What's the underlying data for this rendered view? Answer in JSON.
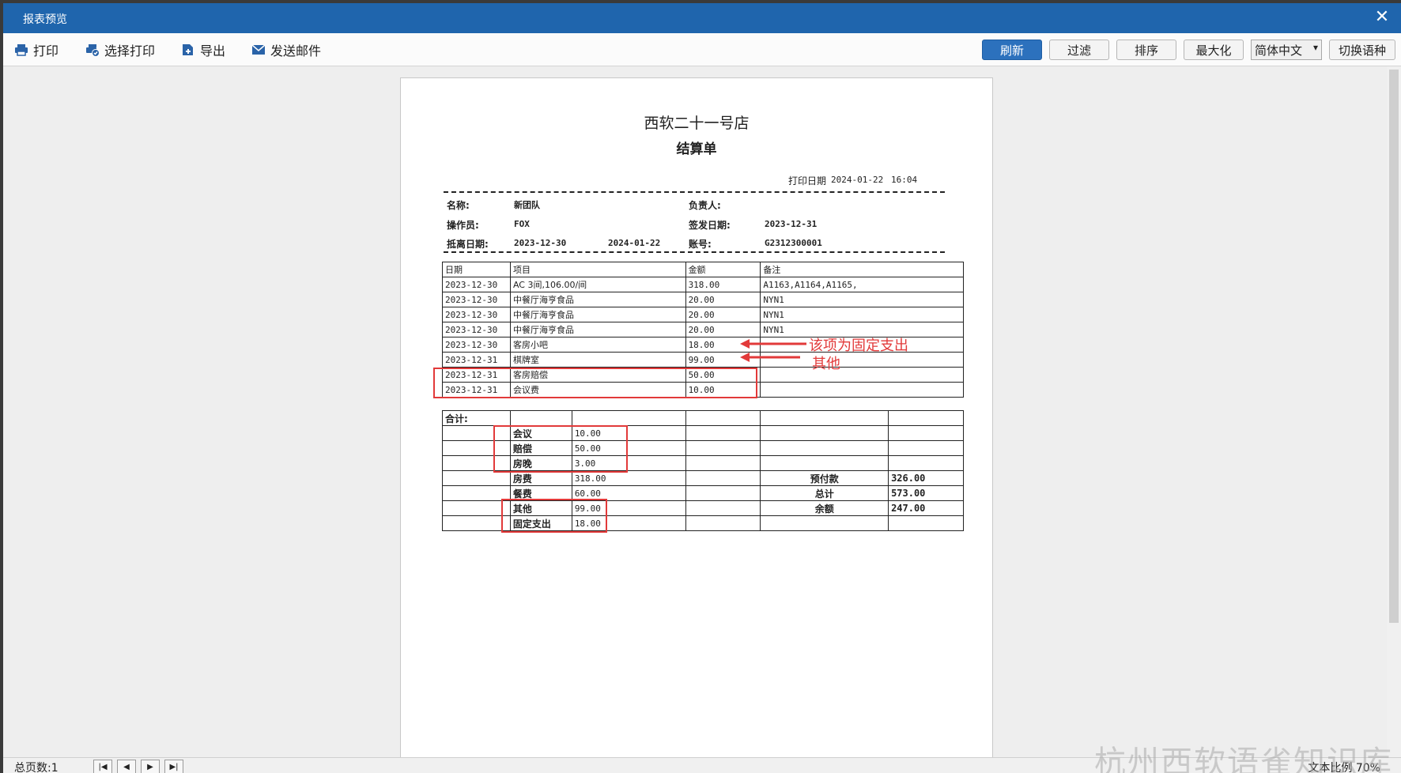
{
  "window": {
    "title": "报表预览",
    "close": "✕"
  },
  "toolbar": {
    "left": [
      {
        "label": "打印",
        "icon": "printer-icon"
      },
      {
        "label": "选择打印",
        "icon": "select-print-icon"
      },
      {
        "label": "导出",
        "icon": "export-icon"
      },
      {
        "label": "发送邮件",
        "icon": "mail-icon"
      }
    ],
    "refresh": "刷新",
    "filter": "过滤",
    "sort": "排序",
    "maximize": "最大化",
    "language": "简体中文",
    "switch_language": "切换语种"
  },
  "report": {
    "hotel": "西软二十一号店",
    "title": "结算单",
    "print_date_label": "打印日期",
    "print_date": "2024-01-22",
    "print_time": "16:04",
    "info": {
      "name_label": "名称:",
      "name": "新团队",
      "manager_label": "负责人:",
      "manager": "",
      "operator_label": "操作员:",
      "operator": "FOX",
      "issue_date_label": "签发日期:",
      "issue_date": "2023-12-31",
      "stay_label": "抵离日期:",
      "arrival": "2023-12-30",
      "departure": "2024-01-22",
      "account_label": "账号:",
      "account": "G2312300001"
    },
    "detail_headers": [
      "日期",
      "项目",
      "金额",
      "备注"
    ],
    "detail_rows": [
      {
        "date": "2023-12-30",
        "item": "AC  3间,106.00/间",
        "amount": "318.00",
        "note": "A1163,A1164,A1165,"
      },
      {
        "date": "2023-12-30",
        "item": "中餐厅海亨食品",
        "amount": "20.00",
        "note": "NYN1"
      },
      {
        "date": "2023-12-30",
        "item": "中餐厅海亨食品",
        "amount": "20.00",
        "note": "NYN1"
      },
      {
        "date": "2023-12-30",
        "item": "中餐厅海亨食品",
        "amount": "20.00",
        "note": "NYN1"
      },
      {
        "date": "2023-12-30",
        "item": "客房小吧",
        "amount": "18.00",
        "note": ""
      },
      {
        "date": "2023-12-31",
        "item": "棋牌室",
        "amount": "99.00",
        "note": ""
      },
      {
        "date": "2023-12-31",
        "item": "客房赔偿",
        "amount": "50.00",
        "note": ""
      },
      {
        "date": "2023-12-31",
        "item": "会议费",
        "amount": "10.00",
        "note": ""
      }
    ],
    "summary": {
      "total_label": "合计:",
      "items": [
        {
          "name": "会议",
          "amount": "10.00"
        },
        {
          "name": "赔偿",
          "amount": "50.00"
        },
        {
          "name": "房晚",
          "amount": "3.00"
        },
        {
          "name": "房费",
          "amount": "318.00"
        },
        {
          "name": "餐费",
          "amount": "60.00"
        },
        {
          "name": "其他",
          "amount": "99.00"
        },
        {
          "name": "固定支出",
          "amount": "18.00"
        }
      ],
      "prepay_label": "预付款",
      "prepay": "326.00",
      "grand_label": "总计",
      "grand": "573.00",
      "balance_label": "余额",
      "balance": "247.00"
    }
  },
  "annotations": {
    "fixed_expense": "该项为固定支出",
    "other": "其他"
  },
  "status": {
    "page_count": "总页数:1",
    "nav": [
      "first-page",
      "prev-page",
      "next-page",
      "last-page"
    ],
    "zoom": "文本比例 70%"
  },
  "watermark": "杭州西软语雀知识库",
  "colors": {
    "titlebar": "#1f65ad",
    "primary_button": "#2c71bd",
    "annotation": "#e23a3a"
  }
}
